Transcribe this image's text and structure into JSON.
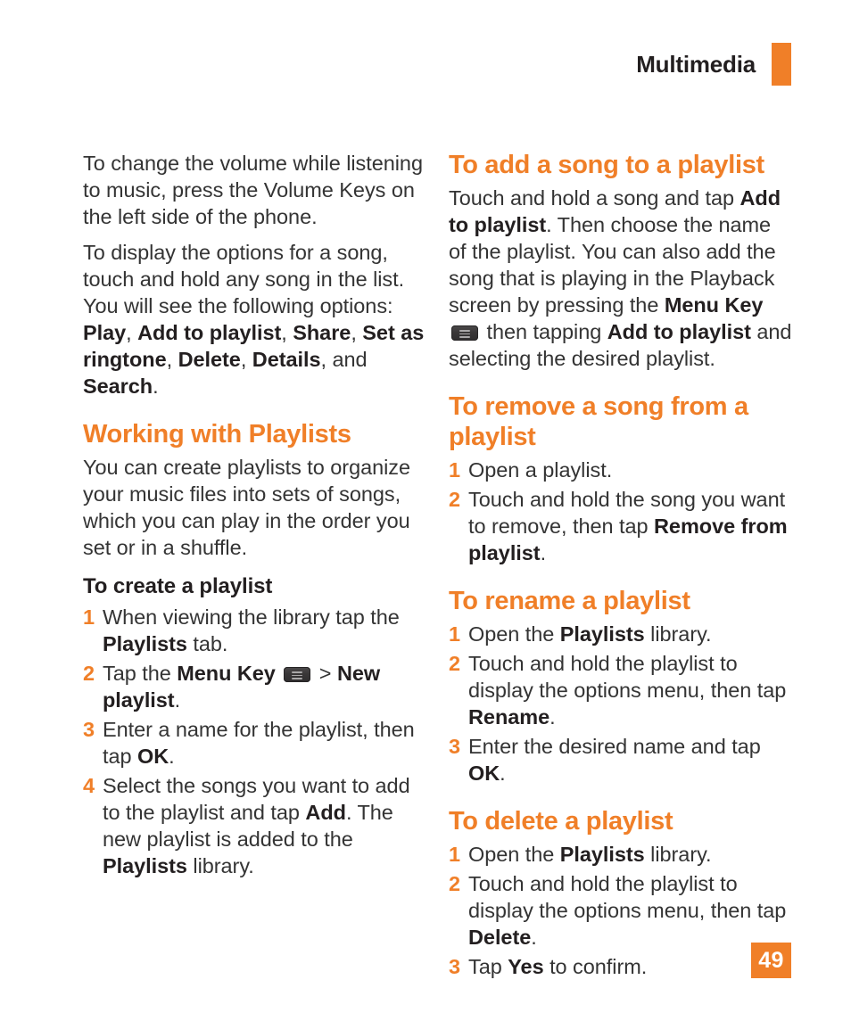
{
  "header": {
    "title": "Multimedia",
    "accent_color": "#f07f28"
  },
  "page_number": "49",
  "icons": {
    "menu_key": "menu-key-icon"
  },
  "left_column": {
    "paragraphs": [
      {
        "id": "volume",
        "runs": [
          {
            "t": "To change the volume while listening to music, press the Volume Keys on the left side of the phone.",
            "b": false
          }
        ]
      },
      {
        "id": "song-options",
        "runs": [
          {
            "t": "To display the options for a song, touch and hold any song in the list. You will see the following options: ",
            "b": false
          },
          {
            "t": "Play",
            "b": true
          },
          {
            "t": ", ",
            "b": false
          },
          {
            "t": "Add to playlist",
            "b": true
          },
          {
            "t": ", ",
            "b": false
          },
          {
            "t": "Share",
            "b": true
          },
          {
            "t": ", ",
            "b": false
          },
          {
            "t": "Set as ringtone",
            "b": true
          },
          {
            "t": ", ",
            "b": false
          },
          {
            "t": "Delete",
            "b": true
          },
          {
            "t": ", ",
            "b": false
          },
          {
            "t": "Details",
            "b": true
          },
          {
            "t": ", and ",
            "b": false
          },
          {
            "t": "Search",
            "b": true
          },
          {
            "t": ".",
            "b": false
          }
        ]
      }
    ],
    "section_heading": "Working with Playlists",
    "section_intro": {
      "runs": [
        {
          "t": "You can create playlists to organize your music files into sets of songs, which you can play in the order you set or in a shuffle.",
          "b": false
        }
      ]
    },
    "sub_heading": "To create a playlist",
    "steps": [
      {
        "num": "1",
        "runs": [
          {
            "t": "When viewing the library tap the ",
            "b": false
          },
          {
            "t": "Playlists",
            "b": true
          },
          {
            "t": " tab.",
            "b": false
          }
        ]
      },
      {
        "num": "2",
        "runs": [
          {
            "t": "Tap the ",
            "b": false
          },
          {
            "t": "Menu Key",
            "b": true
          },
          {
            "t": " ",
            "b": false
          },
          {
            "icon": "menu-key-icon"
          },
          {
            "t": " > ",
            "b": false
          },
          {
            "t": "New playlist",
            "b": true
          },
          {
            "t": ".",
            "b": false
          }
        ]
      },
      {
        "num": "3",
        "runs": [
          {
            "t": "Enter a name for the playlist, then tap ",
            "b": false
          },
          {
            "t": "OK",
            "b": true
          },
          {
            "t": ".",
            "b": false
          }
        ]
      },
      {
        "num": "4",
        "runs": [
          {
            "t": "Select the songs you want to add to the playlist and tap ",
            "b": false
          },
          {
            "t": "Add",
            "b": true
          },
          {
            "t": ". The new playlist is added to the ",
            "b": false
          },
          {
            "t": "Playlists",
            "b": true
          },
          {
            "t": " library.",
            "b": false
          }
        ]
      }
    ]
  },
  "right_column": {
    "sections": [
      {
        "id": "add-song",
        "heading": "To add a song to a playlist",
        "paragraph": {
          "runs": [
            {
              "t": "Touch and hold a song and tap ",
              "b": false
            },
            {
              "t": "Add to playlist",
              "b": true
            },
            {
              "t": ". Then choose the name of the playlist. You can also add the song that is playing in the Playback screen by pressing the ",
              "b": false
            },
            {
              "t": "Menu Key",
              "b": true
            },
            {
              "t": " ",
              "b": false
            },
            {
              "icon": "menu-key-icon"
            },
            {
              "t": " then tapping ",
              "b": false
            },
            {
              "t": "Add to playlist",
              "b": true
            },
            {
              "t": " and selecting the desired playlist.",
              "b": false
            }
          ]
        },
        "steps": []
      },
      {
        "id": "remove-song",
        "heading": "To remove a song from a playlist",
        "steps": [
          {
            "num": "1",
            "runs": [
              {
                "t": "Open a playlist.",
                "b": false
              }
            ]
          },
          {
            "num": "2",
            "runs": [
              {
                "t": "Touch and hold the song you want to remove, then tap ",
                "b": false
              },
              {
                "t": "Remove from playlist",
                "b": true
              },
              {
                "t": ".",
                "b": false
              }
            ]
          }
        ]
      },
      {
        "id": "rename-playlist",
        "heading": "To rename a playlist",
        "steps": [
          {
            "num": "1",
            "runs": [
              {
                "t": "Open the ",
                "b": false
              },
              {
                "t": "Playlists",
                "b": true
              },
              {
                "t": " library.",
                "b": false
              }
            ]
          },
          {
            "num": "2",
            "runs": [
              {
                "t": "Touch and hold the playlist to display the options menu, then tap ",
                "b": false
              },
              {
                "t": "Rename",
                "b": true
              },
              {
                "t": ".",
                "b": false
              }
            ]
          },
          {
            "num": "3",
            "runs": [
              {
                "t": "Enter the desired name and tap ",
                "b": false
              },
              {
                "t": "OK",
                "b": true
              },
              {
                "t": ".",
                "b": false
              }
            ]
          }
        ]
      },
      {
        "id": "delete-playlist",
        "heading": "To delete a playlist",
        "steps": [
          {
            "num": "1",
            "runs": [
              {
                "t": "Open the ",
                "b": false
              },
              {
                "t": "Playlists",
                "b": true
              },
              {
                "t": " library.",
                "b": false
              }
            ]
          },
          {
            "num": "2",
            "runs": [
              {
                "t": "Touch and hold the playlist to display the options menu, then tap ",
                "b": false
              },
              {
                "t": "Delete",
                "b": true
              },
              {
                "t": ".",
                "b": false
              }
            ]
          },
          {
            "num": "3",
            "runs": [
              {
                "t": "Tap ",
                "b": false
              },
              {
                "t": "Yes",
                "b": true
              },
              {
                "t": " to confirm.",
                "b": false
              }
            ]
          }
        ]
      }
    ]
  }
}
